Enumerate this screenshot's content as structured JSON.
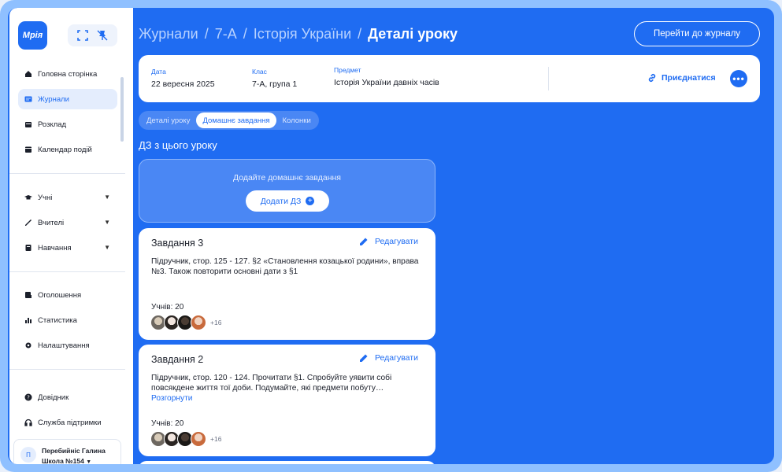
{
  "sidebar": {
    "logo": "Мрія",
    "top_icons": [
      "fullscreen-icon",
      "unpin-icon"
    ],
    "items": [
      {
        "label": "Головна сторінка",
        "icon": "home-icon"
      },
      {
        "label": "Журнали",
        "icon": "journal-icon",
        "active": true
      },
      {
        "label": "Розклад",
        "icon": "calendar-icon"
      },
      {
        "label": "Календар подій",
        "icon": "events-icon"
      },
      {
        "label": "Учні",
        "icon": "graduation-cap-icon",
        "expandable": true
      },
      {
        "label": "Вчителі",
        "icon": "teacher-icon",
        "expandable": true
      },
      {
        "label": "Навчання",
        "icon": "book-icon",
        "expandable": true
      },
      {
        "label": "Оголошення",
        "icon": "announcement-icon"
      },
      {
        "label": "Статистика",
        "icon": "stats-icon"
      },
      {
        "label": "Налаштування",
        "icon": "gear-icon"
      },
      {
        "label": "Довідник",
        "icon": "help-icon"
      },
      {
        "label": "Служба підтримки",
        "icon": "headset-icon"
      }
    ],
    "user": {
      "initial": "П",
      "name": "Перебийніс Галина",
      "school": "Школа №154"
    }
  },
  "header": {
    "breadcrumb": [
      "Журнали",
      "7-А",
      "Історія України"
    ],
    "current": "Деталі уроку",
    "journal_button": "Перейти до журналу"
  },
  "lesson_info": {
    "date_label": "Дата",
    "date": "22 вересня 2025",
    "class_label": "Клас",
    "class": "7-А, група 1",
    "subject_label": "Предмет",
    "subject": "Історія України давніх часів",
    "join_label": "Приєднатися",
    "more": "•••"
  },
  "tabs": [
    {
      "label": "Деталі уроку"
    },
    {
      "label": "Домашнє завдання",
      "active": true
    },
    {
      "label": "Колонки"
    }
  ],
  "homework": {
    "section_title": "ДЗ з цього уроку",
    "add_hint": "Додайте домашнє завдання",
    "add_button": "Додати ДЗ",
    "edit_label": "Редагувати",
    "tasks": [
      {
        "title": "Завдання 3",
        "text": "Підручник, стор. 125 - 127. §2 «Становлення козацької родини», вправа №3. Також повторити основні дати з §1",
        "students": "Учнів: 20",
        "more_count": "+16"
      },
      {
        "title": "Завдання 2",
        "text": "Підручник, стор. 120 - 124. Прочитати §1. Спробуйте уявити собі повсякдене життя тої доби. Подумайте, які предмети побуту…",
        "expand": "Розгорнути",
        "students": "Учнів: 20",
        "more_count": "+16"
      }
    ]
  },
  "colors": {
    "brand": "#1f6cf2",
    "background_blue": "#1f6cf2",
    "card": "#ffffff"
  }
}
